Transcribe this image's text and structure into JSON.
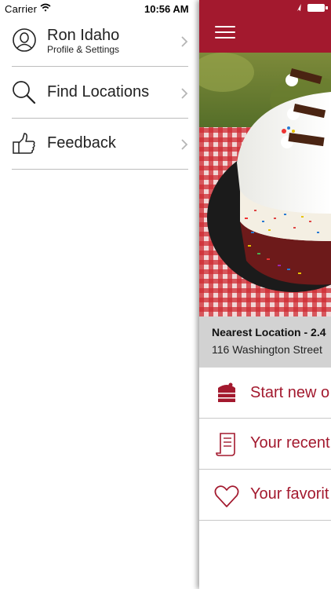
{
  "status_bar": {
    "carrier": "Carrier",
    "time": "10:56 AM"
  },
  "menu": {
    "items": [
      {
        "label": "Ron Idaho",
        "sublabel": "Profile & Settings",
        "icon": "user-icon"
      },
      {
        "label": "Find Locations",
        "icon": "search-icon"
      },
      {
        "label": "Feedback",
        "icon": "thumbs-up-icon"
      }
    ]
  },
  "main": {
    "nearest_location": {
      "title": "Nearest Location - 2.4",
      "address": "116 Washington Street"
    },
    "actions": [
      {
        "label": "Start new o",
        "icon": "cake-icon"
      },
      {
        "label": "Your recent",
        "icon": "receipt-icon"
      },
      {
        "label": "Your favorit",
        "icon": "heart-icon"
      }
    ]
  },
  "colors": {
    "brand_red": "#a3192e",
    "location_bar": "#d2d2d2",
    "divider": "#bdbdbd"
  }
}
